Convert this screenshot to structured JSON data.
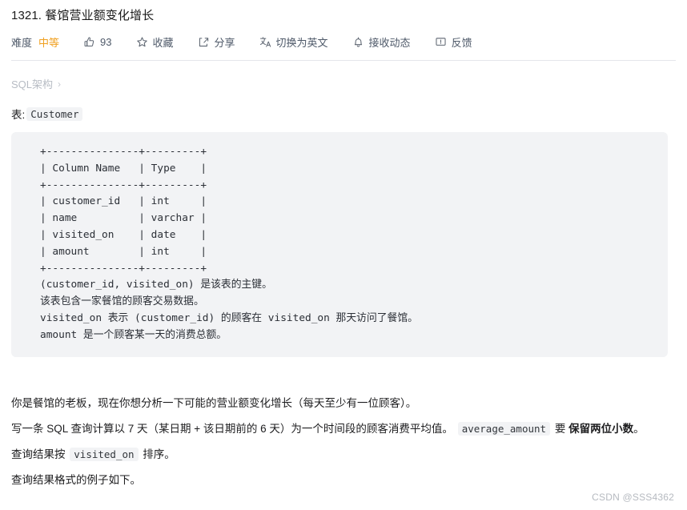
{
  "title": "1321. 餐馆营业额变化增长",
  "meta": {
    "difficulty_label": "难度",
    "difficulty_value": "中等",
    "like_count": "93",
    "favorite_label": "收藏",
    "share_label": "分享",
    "translate_label": "切换为英文",
    "subscribe_label": "接收动态",
    "feedback_label": "反馈",
    "difficulty_color": "#f0a020"
  },
  "breadcrumb": {
    "label": "SQL架构",
    "chevron": "›"
  },
  "table_line": {
    "prefix": "表:",
    "table_name": "Customer"
  },
  "code_block": {
    "schema": "+---------------+---------+\n| Column Name   | Type    |\n+---------------+---------+\n| customer_id   | int     |\n| name          | varchar |\n| visited_on    | date    |\n| amount        | int     |\n+---------------+---------+",
    "description": "(customer_id, visited_on) 是该表的主键。\n该表包含一家餐馆的顾客交易数据。\nvisited_on 表示 (customer_id) 的顾客在 visited_on 那天访问了餐馆。\namount 是一个顾客某一天的消费总额。"
  },
  "body": {
    "para1": "你是餐馆的老板，现在你想分析一下可能的营业额变化增长（每天至少有一位顾客）。",
    "para2_part1": "写一条 SQL 查询计算以 7 天（某日期 + 该日期前的 6 天）为一个时间段的顾客消费平均值。",
    "para2_code": "average_amount",
    "para2_part2": "要",
    "para2_bold": "保留两位小数",
    "para2_end": "。",
    "para3_part1": "查询结果按",
    "para3_code": "visited_on",
    "para3_part2": "排序。",
    "para4": "查询结果格式的例子如下。"
  },
  "watermark": "CSDN @SSS4362"
}
